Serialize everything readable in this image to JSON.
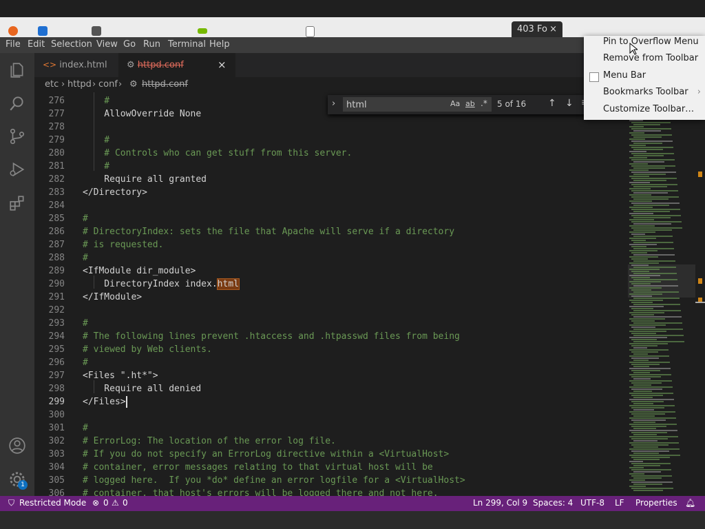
{
  "browser": {
    "tab_title": "403 Fo",
    "tab_close": "×"
  },
  "menubar": {
    "items": [
      "File",
      "Edit",
      "Selection",
      "View",
      "Go",
      "Run",
      "Terminal",
      "Help"
    ]
  },
  "tabs": [
    {
      "label": "index.html",
      "icon": "html-file-icon"
    },
    {
      "label": "httpd.conf",
      "icon": "gear-icon",
      "close": "×"
    }
  ],
  "breadcrumb": {
    "parts": [
      "etc",
      "httpd",
      "conf",
      "httpd.conf"
    ],
    "sep": "›"
  },
  "find": {
    "query": "html",
    "match_case": "Aa",
    "whole_word": "ab",
    "regex": ".*",
    "count": "5 of 16"
  },
  "editor": {
    "lines": [
      {
        "n": "276",
        "t": "    #",
        "c": true
      },
      {
        "n": "277",
        "t": "    AllowOverride None",
        "c": false
      },
      {
        "n": "278",
        "t": "",
        "c": false
      },
      {
        "n": "279",
        "t": "    #",
        "c": true
      },
      {
        "n": "280",
        "t": "    # Controls who can get stuff from this server.",
        "c": true
      },
      {
        "n": "281",
        "t": "    #",
        "c": true
      },
      {
        "n": "282",
        "t": "    Require all granted",
        "c": false
      },
      {
        "n": "283",
        "t": "</Directory>",
        "c": false
      },
      {
        "n": "284",
        "t": "",
        "c": false
      },
      {
        "n": "285",
        "t": "#",
        "c": true
      },
      {
        "n": "286",
        "t": "# DirectoryIndex: sets the file that Apache will serve if a directory",
        "c": true
      },
      {
        "n": "287",
        "t": "# is requested.",
        "c": true
      },
      {
        "n": "288",
        "t": "#",
        "c": true
      },
      {
        "n": "289",
        "t": "<IfModule dir_module>",
        "c": false
      },
      {
        "n": "290",
        "t": "    DirectoryIndex index.",
        "c": false,
        "hl": "html"
      },
      {
        "n": "291",
        "t": "</IfModule>",
        "c": false
      },
      {
        "n": "292",
        "t": "",
        "c": false
      },
      {
        "n": "293",
        "t": "#",
        "c": true
      },
      {
        "n": "294",
        "t": "# The following lines prevent .htaccess and .htpasswd files from being",
        "c": true
      },
      {
        "n": "295",
        "t": "# viewed by Web clients.",
        "c": true
      },
      {
        "n": "296",
        "t": "#",
        "c": true
      },
      {
        "n": "297",
        "t": "<Files \".ht*\">",
        "c": false
      },
      {
        "n": "298",
        "t": "    Require all denied",
        "c": false
      },
      {
        "n": "299",
        "t": "</Files>",
        "c": false,
        "active": true
      },
      {
        "n": "300",
        "t": "",
        "c": false
      },
      {
        "n": "301",
        "t": "#",
        "c": true
      },
      {
        "n": "302",
        "t": "# ErrorLog: The location of the error log file.",
        "c": true
      },
      {
        "n": "303",
        "t": "# If you do not specify an ErrorLog directive within a <VirtualHost>",
        "c": true
      },
      {
        "n": "304",
        "t": "# container, error messages relating to that virtual host will be",
        "c": true
      },
      {
        "n": "305",
        "t": "# logged here.  If you *do* define an error logfile for a <VirtualHost>",
        "c": true
      },
      {
        "n": "306",
        "t": "# container, that host's errors will be logged there and not here.",
        "c": true
      }
    ]
  },
  "statusbar": {
    "restricted": "Restricted Mode",
    "errors": "0",
    "warnings": "0",
    "position": "Ln 299, Col 9",
    "spaces": "Spaces: 4",
    "encoding": "UTF-8",
    "eol": "LF",
    "language": "Properties",
    "settings_badge": "1"
  },
  "context_menu": {
    "items": [
      "Pin to Overflow Menu",
      "Remove from Toolbar",
      "Menu Bar",
      "Bookmarks Toolbar",
      "Customize Toolbar…"
    ],
    "submenu_arrow": "›"
  },
  "colors": {
    "statusbar": "#68217a",
    "comment": "#6a9955",
    "highlight": "#7a3b12"
  }
}
